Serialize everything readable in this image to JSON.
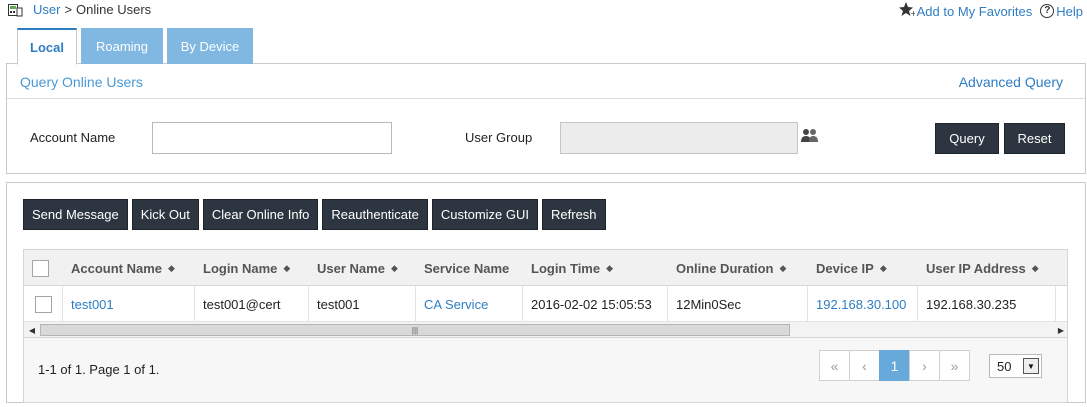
{
  "breadcrumb": {
    "root": "User",
    "separator": ">",
    "current": "Online Users"
  },
  "top_links": {
    "favorites": "Add to My Favorites",
    "help": "Help"
  },
  "tabs": [
    {
      "label": "Local",
      "active": true
    },
    {
      "label": "Roaming",
      "active": false
    },
    {
      "label": "By Device",
      "active": false
    }
  ],
  "query": {
    "title": "Query Online Users",
    "advanced": "Advanced Query",
    "account_name_label": "Account Name",
    "account_name_value": "",
    "user_group_label": "User Group",
    "user_group_value": "",
    "query_button": "Query",
    "reset_button": "Reset"
  },
  "toolbar": {
    "send_message": "Send Message",
    "kick_out": "Kick Out",
    "clear_online_info": "Clear Online Info",
    "reauthenticate": "Reauthenticate",
    "customize_gui": "Customize GUI",
    "refresh": "Refresh"
  },
  "table": {
    "columns": [
      "Account Name",
      "Login Name",
      "User Name",
      "Service Name",
      "Login Time",
      "Online Duration",
      "Device IP",
      "User IP Address"
    ],
    "rows": [
      {
        "account_name": "test001",
        "login_name": "test001@cert",
        "user_name": "test001",
        "service_name": "CA Service",
        "login_time": "2016-02-02 15:05:53",
        "online_duration": "12Min0Sec",
        "device_ip": "192.168.30.100",
        "user_ip": "192.168.30.235"
      }
    ]
  },
  "pagination": {
    "summary": "1-1 of 1. Page 1 of 1.",
    "first": "«",
    "prev": "‹",
    "current_page": "1",
    "next": "›",
    "last": "»",
    "page_size": "50"
  },
  "colors": {
    "accent": "#2e7dc3",
    "button_dark": "#2d3640",
    "tab_inactive": "#80b8e2",
    "page_current": "#66a9da"
  },
  "icons": [
    "home-icon",
    "favorite-star-icon",
    "help-icon",
    "user-group-select-icon",
    "sort-icon",
    "scroll-left-icon",
    "scroll-right-icon",
    "dropdown-arrow-icon"
  ]
}
